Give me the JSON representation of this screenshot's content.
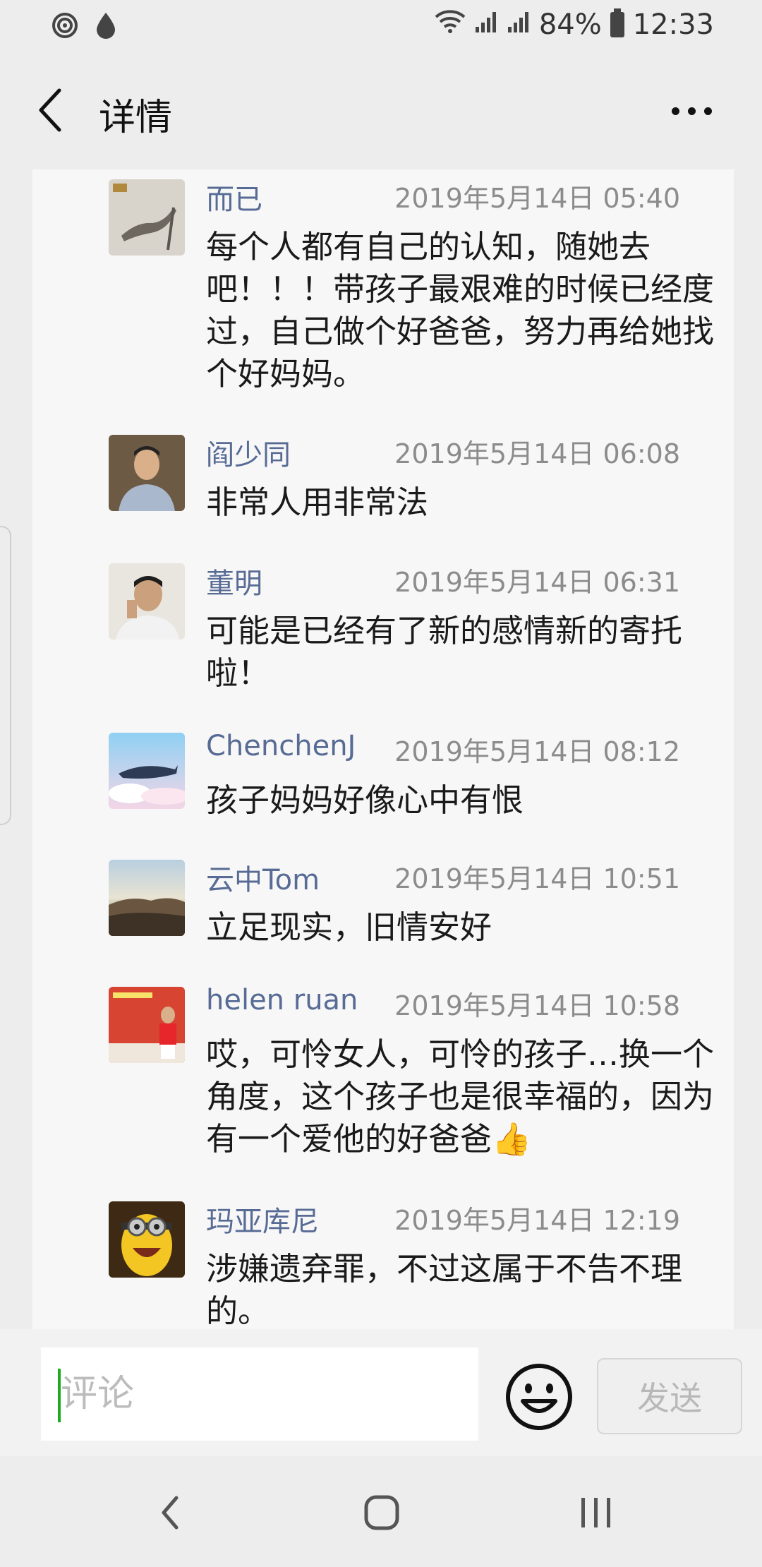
{
  "status_bar": {
    "battery": "84%",
    "time": "12:33",
    "icons": [
      "sync-icon",
      "drop-icon",
      "wifi-icon",
      "signal-icon",
      "signal-icon",
      "battery-icon"
    ]
  },
  "header": {
    "title": "详情",
    "back_icon": "chevron-left-icon",
    "more_icon": "more-dots-icon"
  },
  "comments": [
    {
      "user": "而已",
      "time": "2019年5月14日 05:40",
      "text": "每个人都有自己的认知，随她去吧！！！带孩子最艰难的时候已经度过，自己做个好爸爸，努力再给她找个好妈妈。"
    },
    {
      "user": "阎少同",
      "time": "2019年5月14日 06:08",
      "text": "非常人用非常法"
    },
    {
      "user": "董明",
      "time": "2019年5月14日 06:31",
      "text": "可能是已经有了新的感情新的寄托啦！"
    },
    {
      "user": "ChenchenJ",
      "time": "2019年5月14日 08:12",
      "text": "孩子妈妈好像心中有恨"
    },
    {
      "user": "云中Tom",
      "time": "2019年5月14日 10:51",
      "text": "立足现实，旧情安好"
    },
    {
      "user": "helen ruan",
      "time": "2019年5月14日 10:58",
      "text": "哎，可怜女人，可怜的孩子…换一个角度，这个孩子也是很幸福的，因为有一个爱他的好爸爸👍"
    },
    {
      "user": "玛亚库尼",
      "time": "2019年5月14日 12:19",
      "text": "涉嫌遗弃罪，不过这属于不告不理的。"
    }
  ],
  "input": {
    "placeholder": "评论",
    "emoji_icon": "smiley-icon",
    "send_label": "发送"
  },
  "nav": {
    "icons": [
      "back-nav-icon",
      "home-nav-icon",
      "recents-nav-icon"
    ]
  }
}
